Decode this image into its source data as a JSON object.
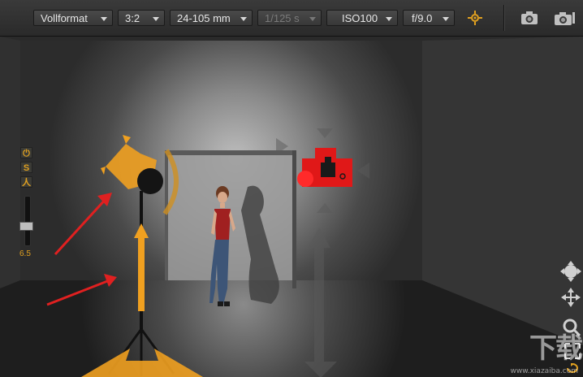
{
  "toolbar": {
    "format": "Vollformat",
    "aspect": "3:2",
    "lens": "24-105 mm",
    "shutter": "1/125 s",
    "iso": "ISO100",
    "aperture": "f/9.0"
  },
  "side_panel": {
    "power_label": "⏻",
    "s_label": "S",
    "person_label": "人",
    "value": "6.5"
  },
  "watermark": {
    "logo_text": "下载",
    "url_text": "www.xiazaiba.com"
  },
  "colors": {
    "accent": "#e0a020",
    "light_orange": "#f0a020",
    "camera_red": "#e01818",
    "arrow_red": "#e02020"
  }
}
